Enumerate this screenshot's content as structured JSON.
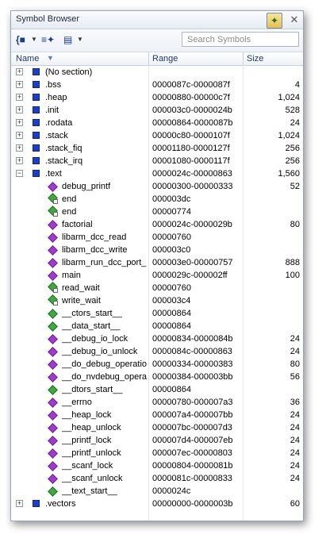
{
  "window": {
    "title": "Symbol Browser"
  },
  "toolbar": {
    "group_icon": "brace-icon",
    "filter_icon": "filter-icon",
    "view_icon": "view-icon",
    "search_placeholder": "Search Symbols",
    "search_value": ""
  },
  "columns": {
    "name": "Name",
    "range": "Range",
    "size": "Size"
  },
  "rows": [
    {
      "level": 0,
      "toggle": "+",
      "icon": "section",
      "name": "(No section)",
      "range": "",
      "size": ""
    },
    {
      "level": 0,
      "toggle": "+",
      "icon": "section",
      "name": ".bss",
      "range": "0000087c-0000087f",
      "size": "4"
    },
    {
      "level": 0,
      "toggle": "+",
      "icon": "section",
      "name": ".heap",
      "range": "00000880-00000c7f",
      "size": "1,024"
    },
    {
      "level": 0,
      "toggle": "+",
      "icon": "section",
      "name": ".init",
      "range": "000003c0-0000024b",
      "size": "528"
    },
    {
      "level": 0,
      "toggle": "+",
      "icon": "section",
      "name": ".rodata",
      "range": "00000864-0000087b",
      "size": "24"
    },
    {
      "level": 0,
      "toggle": "+",
      "icon": "section",
      "name": ".stack",
      "range": "00000c80-0000107f",
      "size": "1,024"
    },
    {
      "level": 0,
      "toggle": "+",
      "icon": "section",
      "name": ".stack_fiq",
      "range": "00001180-0000127f",
      "size": "256"
    },
    {
      "level": 0,
      "toggle": "+",
      "icon": "section",
      "name": ".stack_irq",
      "range": "00001080-0000117f",
      "size": "256"
    },
    {
      "level": 0,
      "toggle": "-",
      "icon": "section",
      "name": ".text",
      "range": "0000024c-00000863",
      "size": "1,560"
    },
    {
      "level": 1,
      "toggle": "",
      "icon": "func",
      "name": "debug_printf",
      "range": "00000300-00000333",
      "size": "52"
    },
    {
      "level": 1,
      "toggle": "",
      "icon": "label-ext",
      "name": "end",
      "range": "000003dc",
      "size": ""
    },
    {
      "level": 1,
      "toggle": "",
      "icon": "label-ext",
      "name": "end",
      "range": "00000774",
      "size": ""
    },
    {
      "level": 1,
      "toggle": "",
      "icon": "func",
      "name": "factorial",
      "range": "0000024c-0000029b",
      "size": "80"
    },
    {
      "level": 1,
      "toggle": "",
      "icon": "func",
      "name": "libarm_dcc_read",
      "range": "00000760",
      "size": ""
    },
    {
      "level": 1,
      "toggle": "",
      "icon": "func",
      "name": "libarm_dcc_write",
      "range": "000003c0",
      "size": ""
    },
    {
      "level": 1,
      "toggle": "",
      "icon": "func",
      "name": "libarm_run_dcc_port_",
      "range": "000003e0-00000757",
      "size": "888"
    },
    {
      "level": 1,
      "toggle": "",
      "icon": "func",
      "name": "main",
      "range": "0000029c-000002ff",
      "size": "100"
    },
    {
      "level": 1,
      "toggle": "",
      "icon": "label-ext",
      "name": "read_wait",
      "range": "00000760",
      "size": ""
    },
    {
      "level": 1,
      "toggle": "",
      "icon": "label-ext",
      "name": "write_wait",
      "range": "000003c4",
      "size": ""
    },
    {
      "level": 1,
      "toggle": "",
      "icon": "label",
      "name": "__ctors_start__",
      "range": "00000864",
      "size": ""
    },
    {
      "level": 1,
      "toggle": "",
      "icon": "label",
      "name": "__data_start__",
      "range": "00000864",
      "size": ""
    },
    {
      "level": 1,
      "toggle": "",
      "icon": "func",
      "name": "__debug_io_lock",
      "range": "00000834-0000084b",
      "size": "24"
    },
    {
      "level": 1,
      "toggle": "",
      "icon": "func",
      "name": "__debug_io_unlock",
      "range": "0000084c-00000863",
      "size": "24"
    },
    {
      "level": 1,
      "toggle": "",
      "icon": "func",
      "name": "__do_debug_operatio",
      "range": "00000334-00000383",
      "size": "80"
    },
    {
      "level": 1,
      "toggle": "",
      "icon": "func",
      "name": "__do_nvdebug_opera",
      "range": "00000384-000003bb",
      "size": "56"
    },
    {
      "level": 1,
      "toggle": "",
      "icon": "label",
      "name": "__dtors_start__",
      "range": "00000864",
      "size": ""
    },
    {
      "level": 1,
      "toggle": "",
      "icon": "func",
      "name": "__errno",
      "range": "00000780-000007a3",
      "size": "36"
    },
    {
      "level": 1,
      "toggle": "",
      "icon": "func",
      "name": "__heap_lock",
      "range": "000007a4-000007bb",
      "size": "24"
    },
    {
      "level": 1,
      "toggle": "",
      "icon": "func",
      "name": "__heap_unlock",
      "range": "000007bc-000007d3",
      "size": "24"
    },
    {
      "level": 1,
      "toggle": "",
      "icon": "func",
      "name": "__printf_lock",
      "range": "000007d4-000007eb",
      "size": "24"
    },
    {
      "level": 1,
      "toggle": "",
      "icon": "func",
      "name": "__printf_unlock",
      "range": "000007ec-00000803",
      "size": "24"
    },
    {
      "level": 1,
      "toggle": "",
      "icon": "func",
      "name": "__scanf_lock",
      "range": "00000804-0000081b",
      "size": "24"
    },
    {
      "level": 1,
      "toggle": "",
      "icon": "func",
      "name": "__scanf_unlock",
      "range": "0000081c-00000833",
      "size": "24"
    },
    {
      "level": 1,
      "toggle": "",
      "icon": "label",
      "name": "__text_start__",
      "range": "0000024c",
      "size": ""
    },
    {
      "level": 0,
      "toggle": "+",
      "icon": "section",
      "name": ".vectors",
      "range": "00000000-0000003b",
      "size": "60"
    }
  ]
}
